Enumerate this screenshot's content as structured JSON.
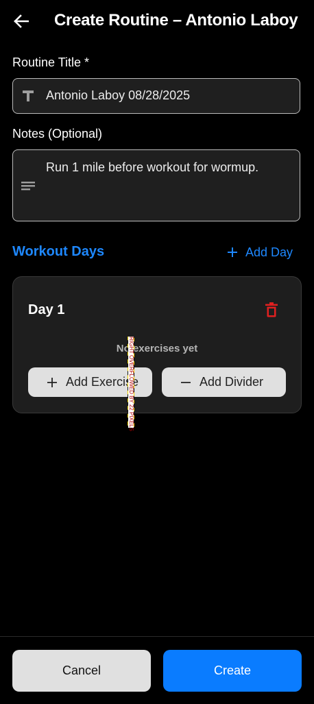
{
  "appbar": {
    "title": "Create Routine – Antonio Laboy",
    "back_icon": "arrow-back-icon"
  },
  "form": {
    "title_label": "Routine Title *",
    "title_value": "Antonio Laboy 08/28/2025",
    "title_icon": "text-format-icon",
    "notes_label": "Notes (Optional)",
    "notes_value": "Run 1 mile before workout for wormup.",
    "notes_icon": "notes-icon"
  },
  "workout_days": {
    "section_title": "Workout Days",
    "add_day_label": "Add Day",
    "days": [
      {
        "title": "Day 1",
        "empty_text": "No exercises yet",
        "add_exercise_label": "Add Exercise",
        "add_divider_label": "Add Divider"
      }
    ]
  },
  "debug_overlay": {
    "overflow_text": "RIGHT OVERFLOWED BY 22 PIXELS"
  },
  "footer": {
    "cancel_label": "Cancel",
    "create_label": "Create"
  },
  "colors": {
    "accent": "#1e88ff",
    "primary_button": "#0a7cff",
    "danger": "#e02020",
    "background": "#000000",
    "card": "#1e1e1e"
  }
}
